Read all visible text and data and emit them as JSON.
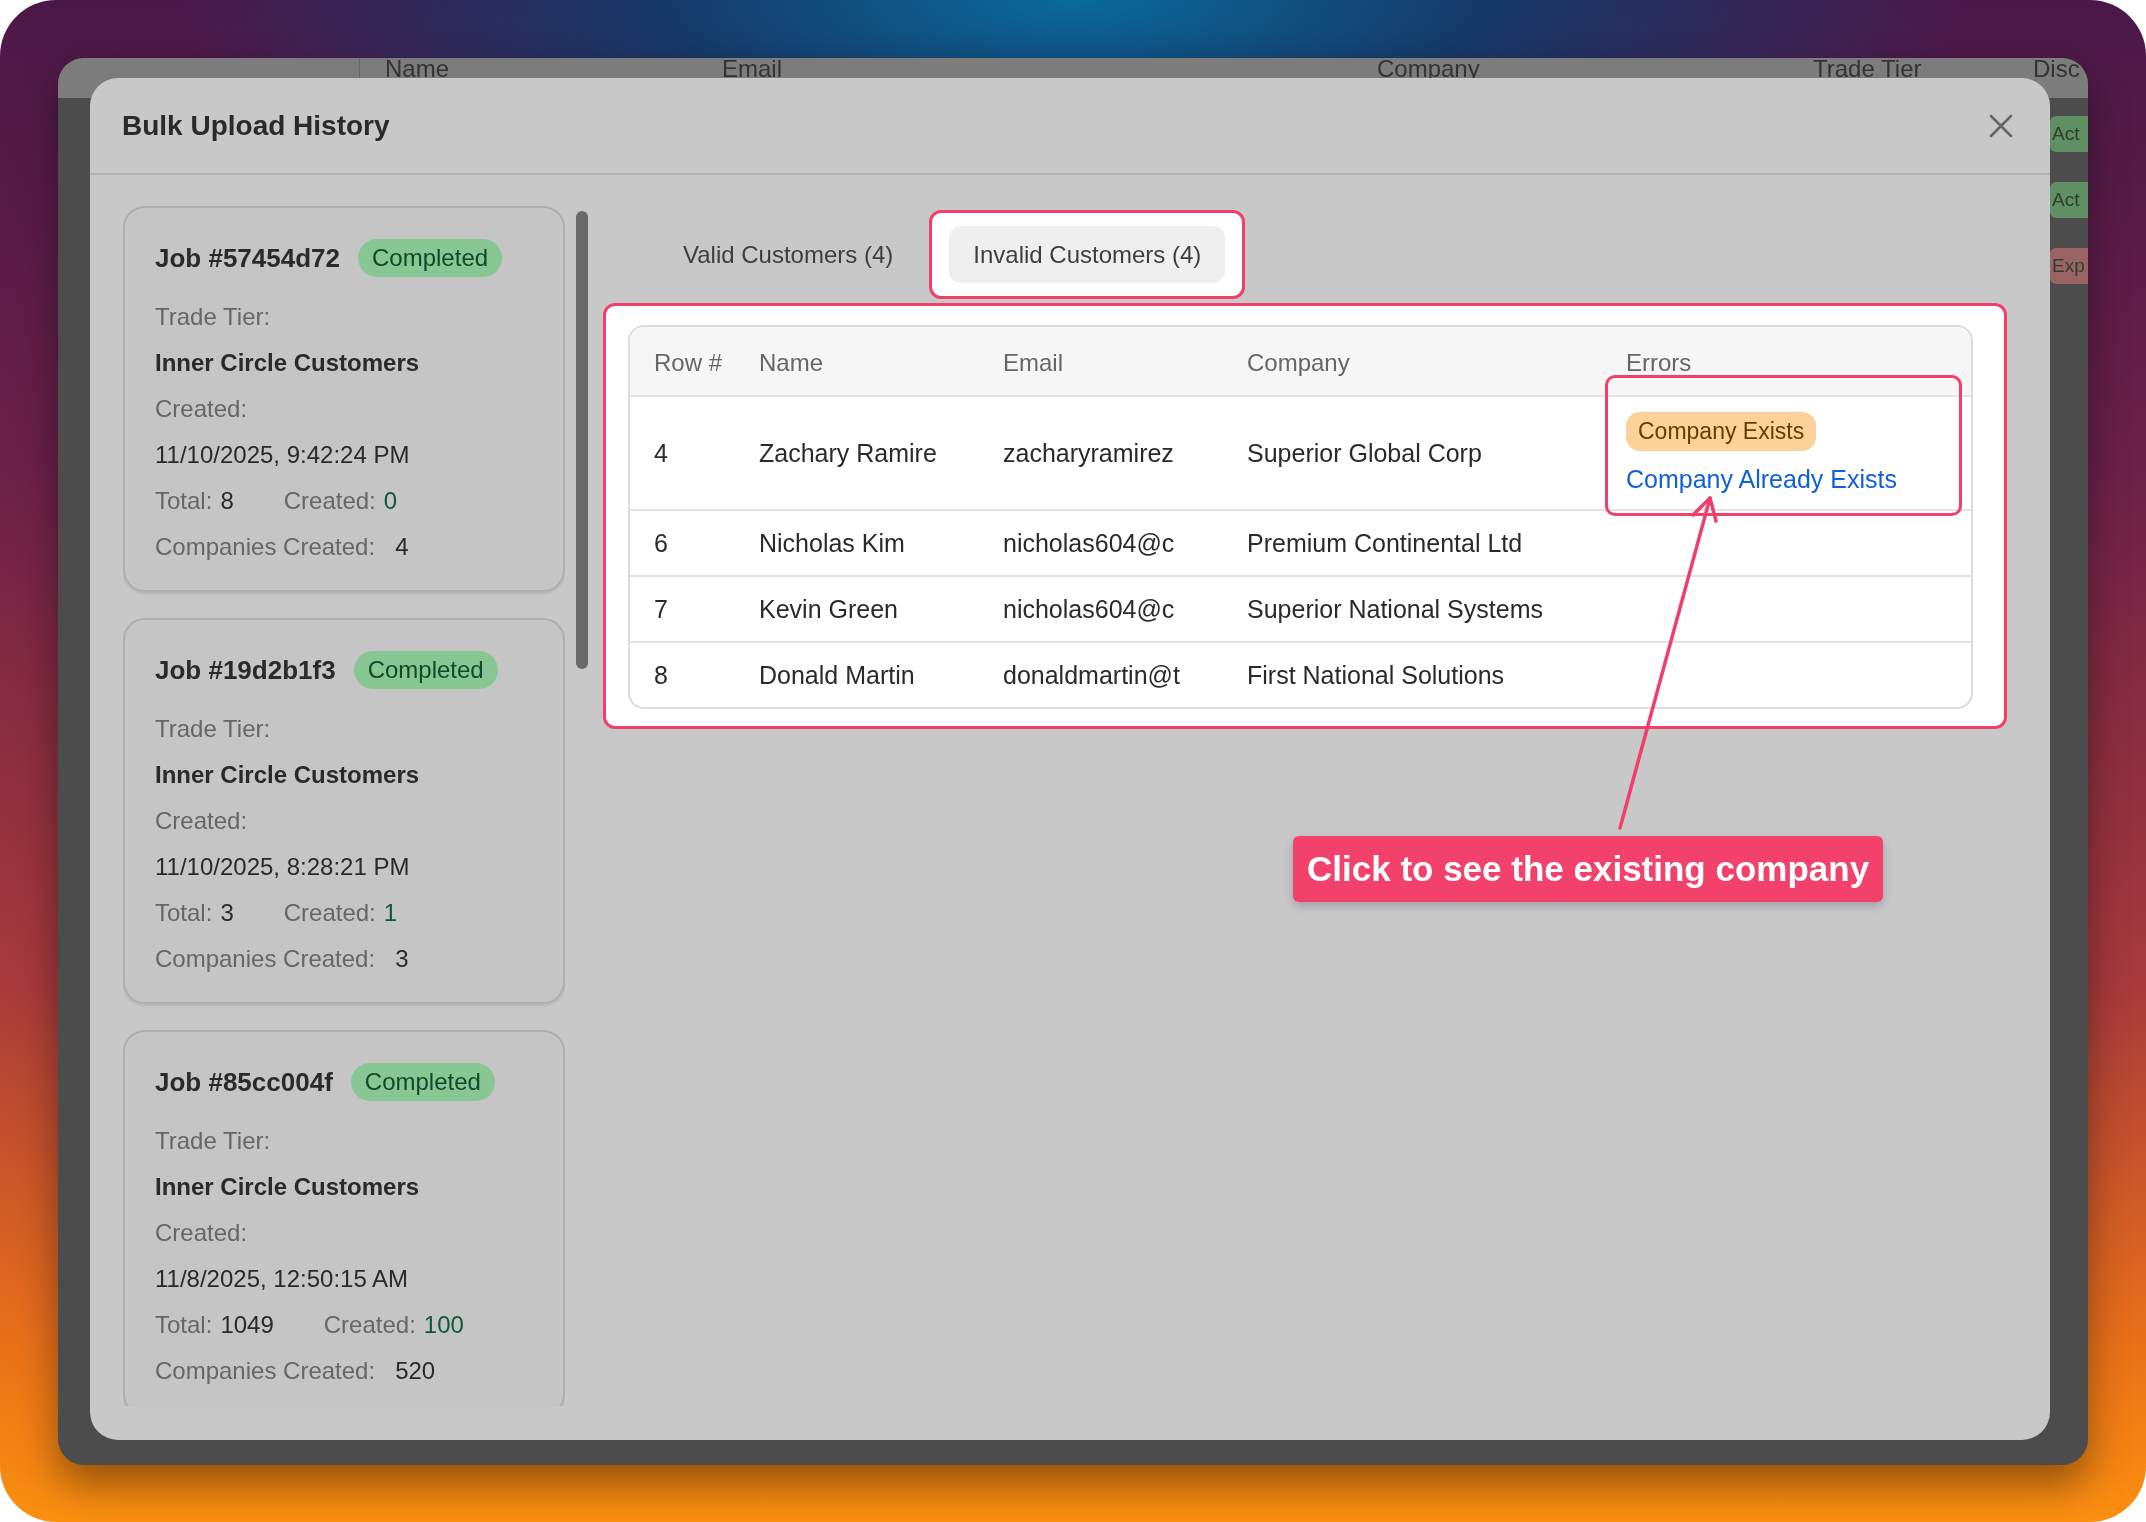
{
  "background_table": {
    "columns": [
      "Name",
      "Email",
      "Company",
      "Trade Tier",
      "Disc"
    ],
    "badges": [
      {
        "text": "Act",
        "color": "#5f8f62"
      },
      {
        "text": "Act",
        "color": "#5f8f62"
      },
      {
        "text": "Exp",
        "color": "#9a6464"
      }
    ]
  },
  "modal": {
    "title": "Bulk Upload History"
  },
  "jobs": [
    {
      "job": "Job #57454d72",
      "status": "Completed",
      "trade_tier_label": "Trade Tier:",
      "trade_tier": "Inner Circle Customers",
      "created_label": "Created:",
      "created_at": "11/10/2025, 9:42:24 PM",
      "total_label": "Total:",
      "total": "8",
      "created_count_label": "Created:",
      "created_count": "0",
      "companies_label": "Companies Created:",
      "companies_created": "4"
    },
    {
      "job": "Job #19d2b1f3",
      "status": "Completed",
      "trade_tier_label": "Trade Tier:",
      "trade_tier": "Inner Circle Customers",
      "created_label": "Created:",
      "created_at": "11/10/2025, 8:28:21 PM",
      "total_label": "Total:",
      "total": "3",
      "created_count_label": "Created:",
      "created_count": "1",
      "companies_label": "Companies Created:",
      "companies_created": "3"
    },
    {
      "job": "Job #85cc004f",
      "status": "Completed",
      "trade_tier_label": "Trade Tier:",
      "trade_tier": "Inner Circle Customers",
      "created_label": "Created:",
      "created_at": "11/8/2025, 12:50:15 AM",
      "total_label": "Total:",
      "total": "1049",
      "created_count_label": "Created:",
      "created_count": "100",
      "companies_label": "Companies Created:",
      "companies_created": "520"
    }
  ],
  "tabs": [
    {
      "label": "Valid Customers (4)",
      "selected": false
    },
    {
      "label": "Invalid Customers (4)",
      "selected": true
    }
  ],
  "table": {
    "columns": [
      "Row #",
      "Name",
      "Email",
      "Company",
      "Errors"
    ],
    "rows": [
      {
        "row": "4",
        "name": "Zachary Ramire",
        "email": "zacharyramirez",
        "company": "Superior Global Corp",
        "errors": [
          {
            "kind": "badge",
            "text": "Company Exists"
          },
          {
            "kind": "link",
            "text": "Company Already Exists"
          }
        ]
      },
      {
        "row": "6",
        "name": "Nicholas Kim",
        "email": "nicholas604@c",
        "company": "Premium Continental Ltd"
      },
      {
        "row": "7",
        "name": "Kevin Green",
        "email": "nicholas604@c",
        "company": "Superior National Systems"
      },
      {
        "row": "8",
        "name": "Donald Martin",
        "email": "donaldmartin@t",
        "company": "First National Solutions"
      }
    ]
  },
  "annotation": {
    "callout": "Click to see the existing company"
  }
}
